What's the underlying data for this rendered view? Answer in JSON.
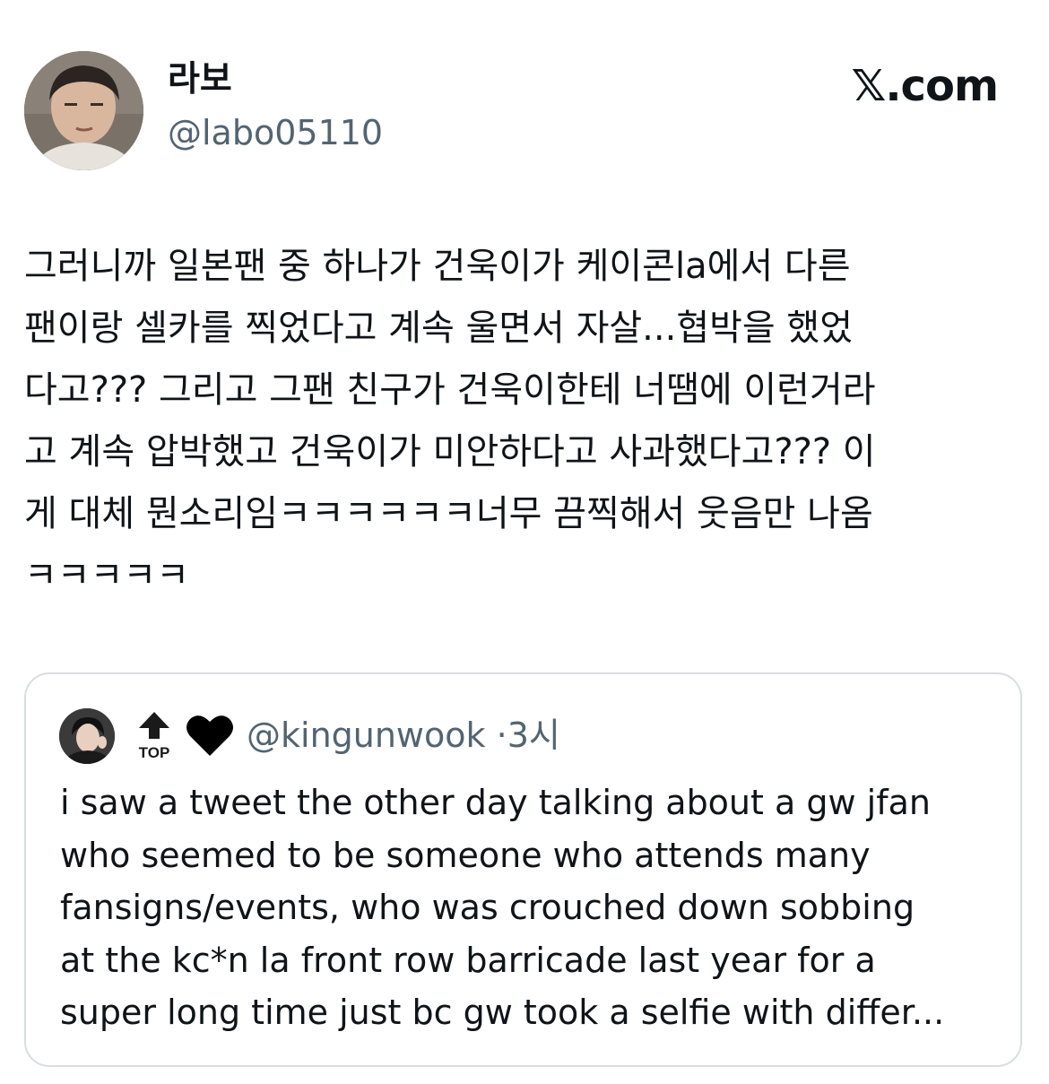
{
  "author": {
    "display_name": "라보",
    "handle": "@labo05110",
    "avatar_icon": "profile-photo"
  },
  "brand": {
    "label": "𝕏.com"
  },
  "tweet": {
    "text": "그러니까 일본팬 중 하나가 건욱이가 케이콘la에서 다른\n팬이랑 셀카를 찍었다고 계속 울면서 자살...협박을 했었\n다고??? 그리고 그팬 친구가 건욱이한테 너땜에 이런거라\n고 계속 압박했고 건욱이가 미안하다고 사과했다고??? 이\n게 대체 뭔소리임ㅋㅋㅋㅋㅋㅋ너무 끔찍해서 웃음만 나옴\nㅋㅋㅋㅋㅋ"
  },
  "quote": {
    "avatar_icon": "profile-photo",
    "top_emoji": "top-arrow-icon",
    "heart_emoji": "black-heart-icon",
    "handle": "@kingunwook",
    "separator": "·",
    "time": "3시",
    "text": "i saw a tweet the other day talking about a gw jfan\nwho seemed to be someone who attends many\nfansigns/events, who was crouched down sobbing\nat the kc*n la front row barricade last year for a\nsuper long time just bc gw took a selfie with differ..."
  },
  "colors": {
    "text": "#0f1419",
    "secondary": "#536471",
    "border": "#d8dde1",
    "background": "#ffffff"
  }
}
